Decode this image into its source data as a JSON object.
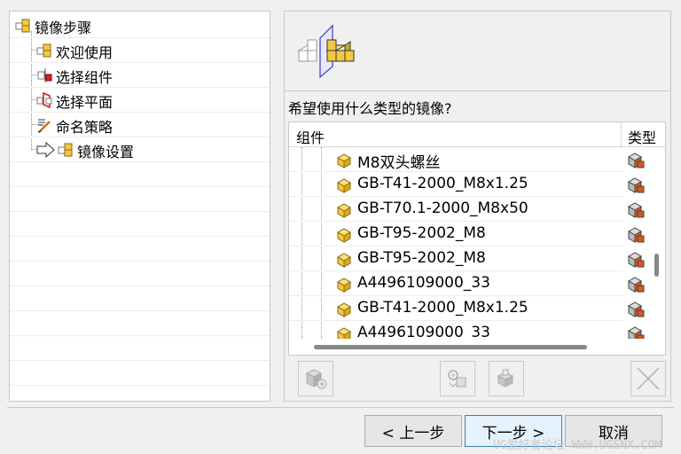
{
  "tree": {
    "root": "镜像步骤",
    "items": [
      {
        "label": "欢迎使用"
      },
      {
        "label": "选择组件"
      },
      {
        "label": "选择平面"
      },
      {
        "label": "命名策略"
      },
      {
        "label": "镜像设置"
      }
    ]
  },
  "main": {
    "question": "希望使用什么类型的镜像?",
    "columns": {
      "name": "组件",
      "type": "类型"
    },
    "rows": [
      "M8双头螺丝",
      "GB-T41-2000_M8x1.25",
      "GB-T70.1-2000_M8x50",
      "GB-T95-2002_M8",
      "GB-T95-2002_M8",
      "A4496109000_33",
      "GB-T41-2000_M8x1.25",
      "A4496109000_33"
    ]
  },
  "footer": {
    "back_label": "< 上一步",
    "next_label": "下一步 >",
    "cancel_label": "取消",
    "watermark": "UG爱好者论坛 WWW.UGSNX.COM"
  },
  "colors": {
    "cube": "#f5c842",
    "cube_dark": "#c79a1a",
    "mirror_plane": "#4455cc",
    "type_icon": "#d45a1c"
  }
}
